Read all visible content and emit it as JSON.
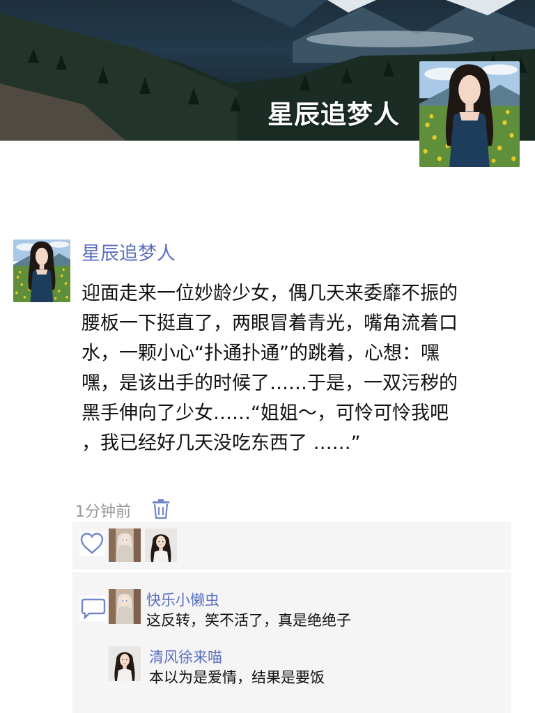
{
  "profile": {
    "name": "星辰追梦人",
    "cover_image": "mountain-forest-landscape",
    "avatar": "woman-in-flower-field-avatar"
  },
  "post": {
    "author": "星辰追梦人",
    "lines": [
      "迎面走来一位妙龄少女，偶几天来委靡不振的",
      "腰板一下挺直了，两眼冒着青光，嘴角流着口",
      "水，一颗小心“扑通扑通”的跳着，心想：嘿",
      "嘿，是该出手的时候了……于是，一双污秽的",
      "黑手伸向了少女……“姐姐～，可怜可怜我吧",
      "，我已经好几天没吃东西了 ……”"
    ],
    "time": "1分钟前"
  },
  "likes": {
    "icon": "heart-icon",
    "users": [
      "anime-girl-avatar",
      "woman-portrait-avatar"
    ]
  },
  "comments": {
    "icon": "comment-bubble-icon",
    "items": [
      {
        "name": "快乐小懒虫",
        "text": "这反转，笑不活了，真是绝绝子",
        "avatar": "anime-girl-avatar"
      },
      {
        "name": "清风徐来喵",
        "text": "本以为是爱情，结果是要饭",
        "avatar": "woman-portrait-avatar"
      }
    ]
  },
  "colors": {
    "link_blue": "#5b6fbf",
    "time_gray": "#999999",
    "panel_bg": "#f5f5f5"
  }
}
